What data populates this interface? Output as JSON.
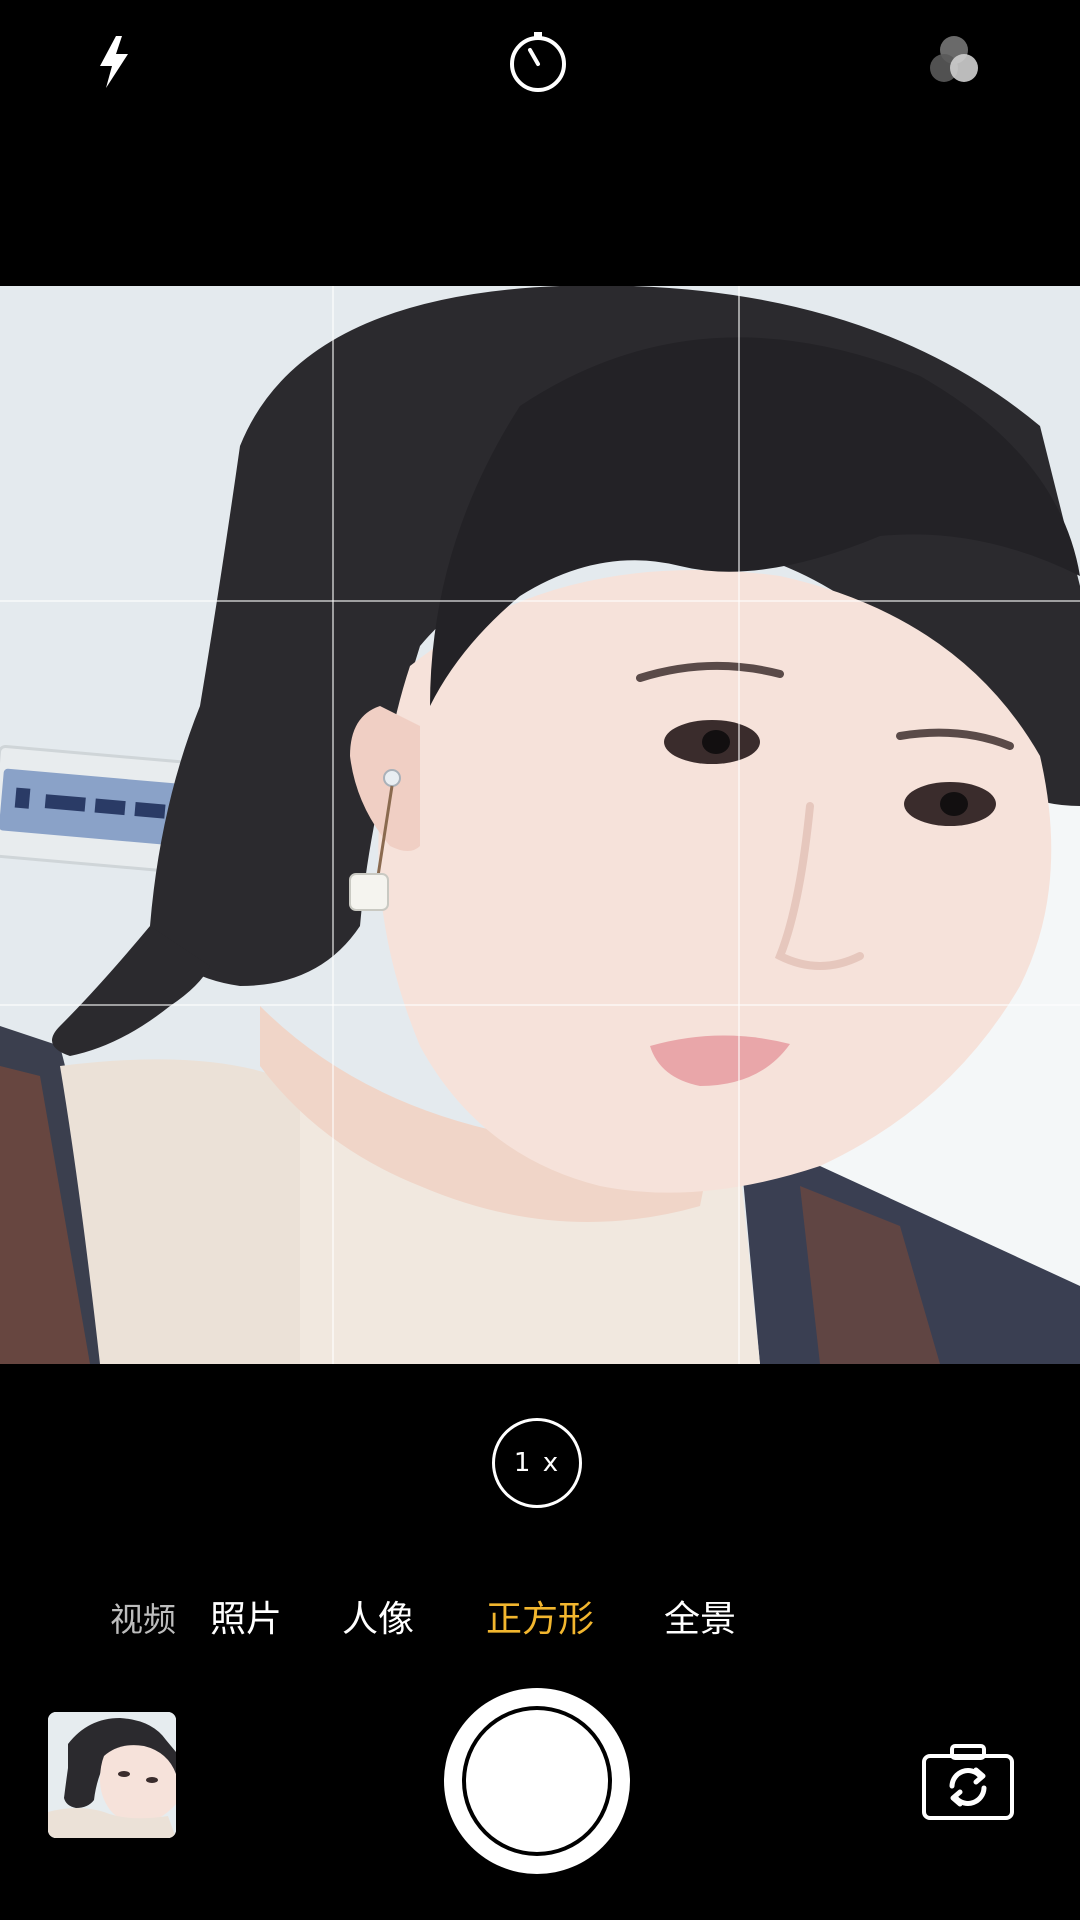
{
  "top_bar": {
    "flash_icon": "lightning-bolt",
    "timer_icon": "stopwatch",
    "filters_icon": "three-circles"
  },
  "viewfinder": {
    "grid": "3x3"
  },
  "zoom": {
    "label": "1 x"
  },
  "modes": [
    {
      "label": "视频"
    },
    {
      "label": "照片"
    },
    {
      "label": "人像"
    },
    {
      "label": "正方形",
      "selected": true
    },
    {
      "label": "全景"
    }
  ],
  "colors": {
    "selected_mode": "#f2b62e",
    "background": "#000000",
    "icon": "#ffffff"
  },
  "bottom_bar": {
    "gallery_icon": "photo-thumbnail",
    "shutter_icon": "shutter",
    "switch_camera_icon": "camera-rotate"
  }
}
